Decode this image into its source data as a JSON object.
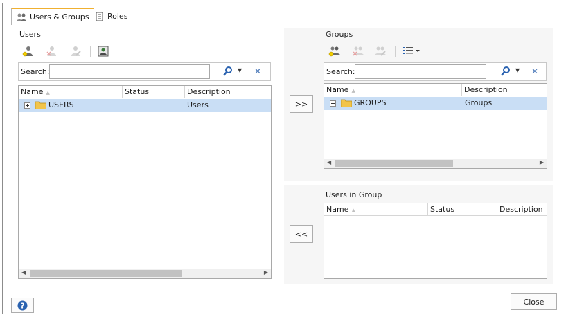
{
  "tabs": [
    {
      "label": "Users & Groups",
      "active": true
    },
    {
      "label": "Roles",
      "active": false
    }
  ],
  "users": {
    "title": "Users",
    "search_label": "Search:",
    "search_value": "",
    "columns": [
      "Name",
      "Status",
      "Description"
    ],
    "rows": [
      {
        "name": "USERS",
        "status": "",
        "description": "Users"
      }
    ]
  },
  "groups": {
    "title": "Groups",
    "search_label": "Search:",
    "search_value": "",
    "columns": [
      "Name",
      "Description"
    ],
    "rows": [
      {
        "name": "GROUPS",
        "description": "Groups"
      }
    ]
  },
  "users_in_group": {
    "title": "Users in Group",
    "columns": [
      "Name",
      "Status",
      "Description"
    ]
  },
  "buttons": {
    "add_to_group": ">>",
    "remove_from_group": "<<",
    "close": "Close"
  },
  "colors": {
    "selection": "#c9def5",
    "accent": "#f0b030"
  }
}
